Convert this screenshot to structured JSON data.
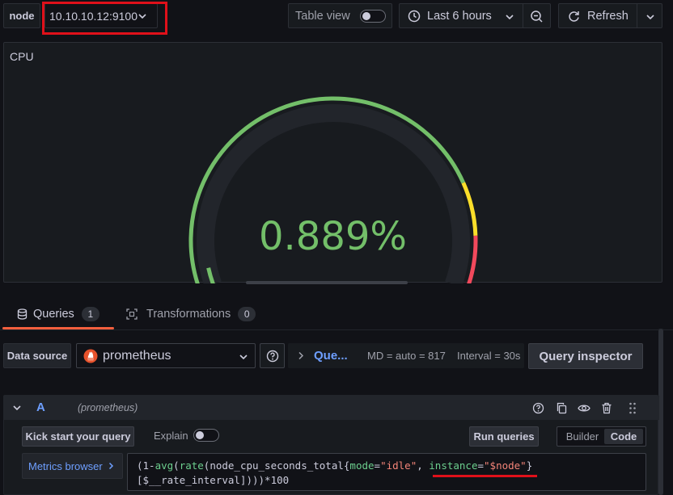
{
  "variables": {
    "node": {
      "label": "node",
      "value": "10.10.10.12:9100"
    }
  },
  "toolbar": {
    "table_view_label": "Table view",
    "table_view_on": false,
    "time_range_label": "Last 6 hours",
    "refresh_label": "Refresh"
  },
  "panel": {
    "title": "CPU",
    "gauge": {
      "value": 0.889,
      "display": "0.889%",
      "min": 0,
      "max": 100,
      "thresholds": [
        {
          "from": 0,
          "to": 80,
          "color": "#73bf69"
        },
        {
          "from": 80,
          "to": 90,
          "color": "#fade2a"
        },
        {
          "from": 90,
          "to": 100,
          "color": "#f2495c"
        }
      ]
    }
  },
  "tabs": [
    {
      "label": "Queries",
      "count": "1",
      "active": true
    },
    {
      "label": "Transformations",
      "count": "0",
      "active": false
    }
  ],
  "datasource": {
    "label": "Data source",
    "value": "prometheus",
    "query_options_title": "Que...",
    "md": "MD = auto = 817",
    "interval": "Interval = 30s",
    "query_inspector_label": "Query inspector"
  },
  "query": {
    "ref_id": "A",
    "datasource_hint": "(prometheus)",
    "kick_start_label": "Kick start your query",
    "explain_label": "Explain",
    "explain_on": false,
    "run_label": "Run queries",
    "mode_builder": "Builder",
    "mode_code": "Code",
    "metrics_browser_label": "Metrics browser",
    "code": {
      "p1": "(1-",
      "fn_avg": "avg",
      "p2": "(",
      "fn_rate": "rate",
      "p3": "(node_cpu_seconds_total{",
      "lbl_mode": "mode",
      "eq1": "=",
      "str_idle": "\"idle\"",
      "comma": ", ",
      "lbl_instance": "instance",
      "eq2": "=",
      "str_node": "\"$node\"",
      "close": "}",
      "line2": "[$__rate_interval])))*100"
    }
  }
}
